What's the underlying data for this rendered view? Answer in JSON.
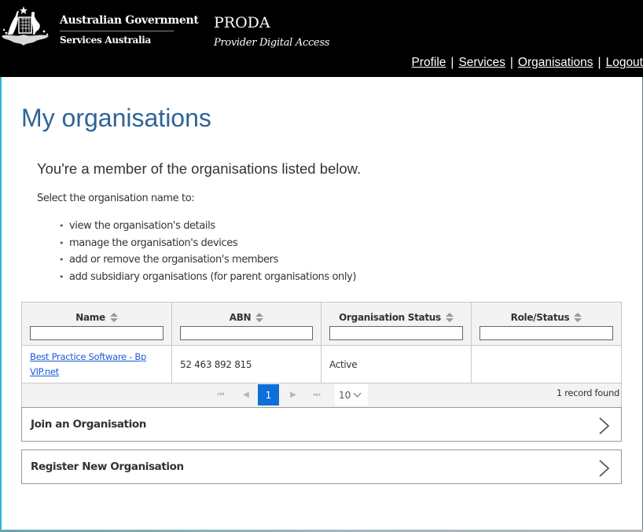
{
  "header": {
    "gov_title": "Australian Government",
    "gov_subtitle": "Services Australia",
    "app_title": "PRODA",
    "app_subtitle": "Provider Digital Access",
    "nav": [
      {
        "label": "Profile"
      },
      {
        "label": "Services"
      },
      {
        "label": "Organisations"
      },
      {
        "label": "Logout"
      }
    ],
    "separator": "|"
  },
  "main": {
    "title": "My organisations",
    "intro": "You're a member of the organisations listed below.",
    "select_text": "Select the organisation name to:",
    "bullets": [
      "view the organisation's details",
      "manage the organisation's devices",
      "add or remove the organisation's members",
      "add subsidiary organisations (for parent organisations only)"
    ]
  },
  "table": {
    "columns": [
      {
        "label": "Name",
        "filter": ""
      },
      {
        "label": "ABN",
        "filter": ""
      },
      {
        "label": "Organisation Status",
        "filter": ""
      },
      {
        "label": "Role/Status",
        "filter": ""
      }
    ],
    "rows": [
      {
        "name": "Best Practice Software - Bp VIP.net",
        "abn": "52 463 892 815",
        "org_status": "Active",
        "role_status": ""
      }
    ],
    "pager": {
      "current_page": "1",
      "page_size": "10",
      "records": "1 record found"
    }
  },
  "actions": {
    "join": "Join an Organisation",
    "register": "Register New Organisation"
  },
  "colors": {
    "header_bg": "#000000",
    "title_blue": "#2f6496",
    "link_blue": "#1a5bd6",
    "pager_active": "#0f6fd8"
  }
}
